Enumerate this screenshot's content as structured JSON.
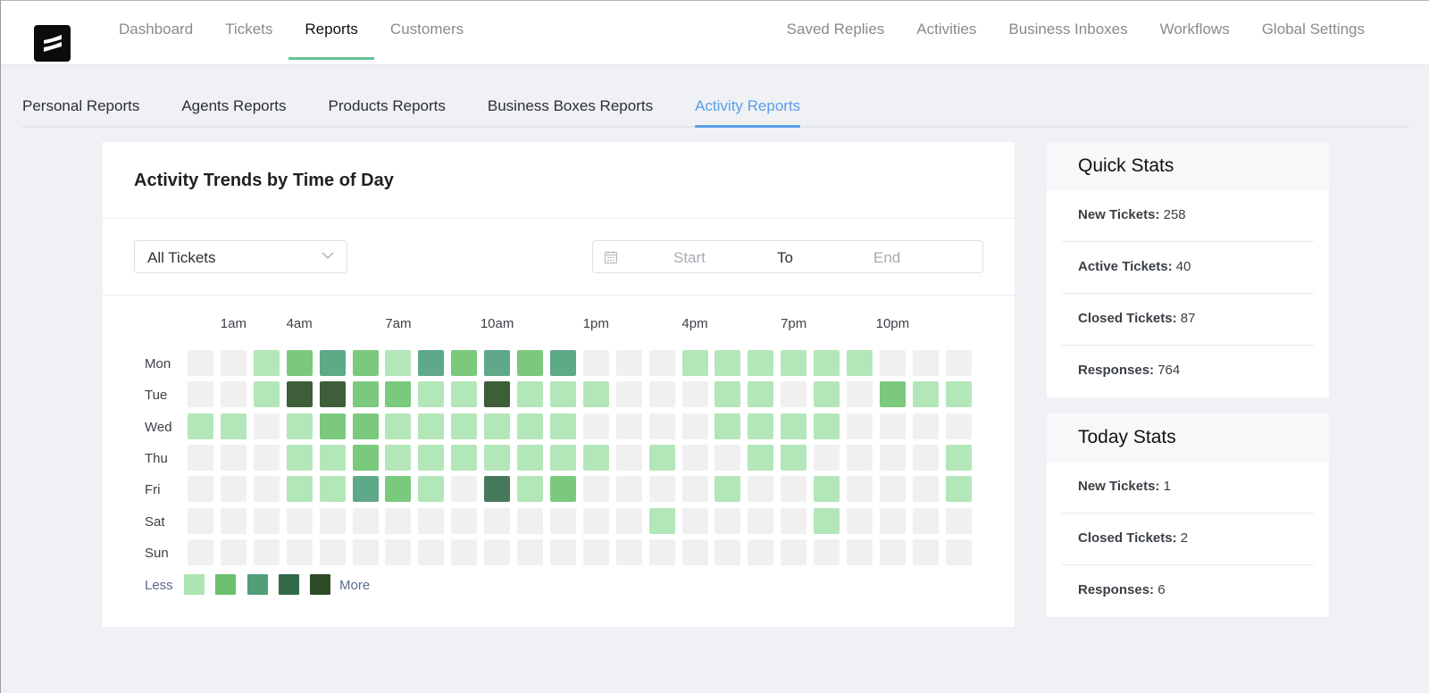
{
  "header": {
    "logo": "fluent-support-logo",
    "nav_left": [
      {
        "label": "Dashboard",
        "active": false
      },
      {
        "label": "Tickets",
        "active": false
      },
      {
        "label": "Reports",
        "active": true
      },
      {
        "label": "Customers",
        "active": false
      }
    ],
    "nav_right": [
      {
        "label": "Saved Replies"
      },
      {
        "label": "Activities"
      },
      {
        "label": "Business Inboxes"
      },
      {
        "label": "Workflows"
      },
      {
        "label": "Global Settings"
      }
    ],
    "accent_color": "#66c493"
  },
  "subtabs": [
    {
      "label": "Personal Reports",
      "active": false
    },
    {
      "label": "Agents Reports",
      "active": false
    },
    {
      "label": "Products Reports",
      "active": false
    },
    {
      "label": "Business Boxes Reports",
      "active": false
    },
    {
      "label": "Activity Reports",
      "active": true
    }
  ],
  "subtab_accent": "#5a9ee8",
  "card": {
    "title": "Activity Trends by Time of Day",
    "ticket_filter": {
      "selected": "All Tickets"
    },
    "date_range": {
      "start_placeholder": "Start",
      "separator": "To",
      "end_placeholder": "End"
    }
  },
  "chart_data": {
    "type": "heatmap",
    "title": "Activity Trends by Time of Day",
    "x_tick_labels": [
      {
        "label": "1am",
        "hour": 1
      },
      {
        "label": "4am",
        "hour": 3
      },
      {
        "label": "7am",
        "hour": 6
      },
      {
        "label": "10am",
        "hour": 9
      },
      {
        "label": "1pm",
        "hour": 12
      },
      {
        "label": "4pm",
        "hour": 15
      },
      {
        "label": "7pm",
        "hour": 18
      },
      {
        "label": "10pm",
        "hour": 21
      }
    ],
    "hours": 24,
    "rows": [
      "Mon",
      "Tue",
      "Wed",
      "Thu",
      "Fri",
      "Sat",
      "Sun"
    ],
    "levels": [
      [
        0,
        0,
        1,
        2,
        3,
        2,
        1,
        3,
        2,
        3,
        2,
        3,
        0,
        0,
        0,
        1,
        1,
        1,
        1,
        1,
        1,
        0,
        0,
        0
      ],
      [
        0,
        0,
        1,
        5,
        5,
        2,
        2,
        1,
        1,
        5,
        1,
        1,
        1,
        0,
        0,
        0,
        1,
        1,
        0,
        1,
        0,
        2,
        1,
        1
      ],
      [
        1,
        1,
        0,
        1,
        2,
        2,
        1,
        1,
        1,
        1,
        1,
        1,
        0,
        0,
        0,
        0,
        1,
        1,
        1,
        1,
        0,
        0,
        0,
        0
      ],
      [
        0,
        0,
        0,
        1,
        1,
        2,
        1,
        1,
        1,
        1,
        1,
        1,
        1,
        0,
        1,
        0,
        0,
        1,
        1,
        0,
        0,
        0,
        0,
        1
      ],
      [
        0,
        0,
        0,
        1,
        1,
        3,
        2,
        1,
        0,
        4,
        1,
        2,
        0,
        0,
        0,
        0,
        1,
        0,
        0,
        1,
        0,
        0,
        0,
        1
      ],
      [
        0,
        0,
        0,
        0,
        0,
        0,
        0,
        0,
        0,
        0,
        0,
        0,
        0,
        0,
        1,
        0,
        0,
        0,
        0,
        1,
        0,
        0,
        0,
        0
      ],
      [
        0,
        0,
        0,
        0,
        0,
        0,
        0,
        0,
        0,
        0,
        0,
        0,
        0,
        0,
        0,
        0,
        0,
        0,
        0,
        0,
        0,
        0,
        0,
        0
      ]
    ],
    "color_scale": [
      "#f0f0f0",
      "#b3e6b8",
      "#7bc97d",
      "#5ea987",
      "#46795a",
      "#3e5e3a"
    ],
    "legend": {
      "less_label": "Less",
      "more_label": "More",
      "swatches": [
        "#aee4b1",
        "#6ac06f",
        "#4f9e79",
        "#336b4a",
        "#2d4b26"
      ],
      "placement": "bottom-left"
    }
  },
  "quick_stats": {
    "title": "Quick Stats",
    "rows": [
      {
        "label": "New Tickets:",
        "value": "258"
      },
      {
        "label": "Active Tickets:",
        "value": "40"
      },
      {
        "label": "Closed Tickets:",
        "value": "87"
      },
      {
        "label": "Responses:",
        "value": "764"
      }
    ]
  },
  "today_stats": {
    "title": "Today Stats",
    "rows": [
      {
        "label": "New Tickets:",
        "value": "1"
      },
      {
        "label": "Closed Tickets:",
        "value": "2"
      },
      {
        "label": "Responses:",
        "value": "6"
      }
    ]
  }
}
